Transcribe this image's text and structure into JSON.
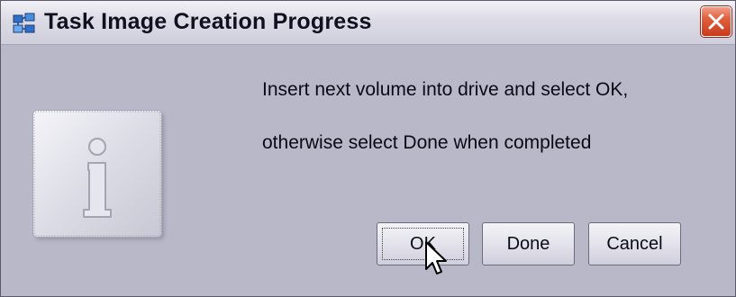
{
  "window": {
    "title": "Task Image Creation Progress",
    "app_icon": "task-image-creation-icon",
    "close_icon": "close-x-icon"
  },
  "dialog": {
    "icon": "information-icon",
    "message_line1": "Insert next volume into drive and select OK,",
    "message_line2": "otherwise select Done when completed"
  },
  "buttons": {
    "ok_label": "OK",
    "done_label": "Done",
    "cancel_label": "Cancel",
    "focused": "OK"
  },
  "colors": {
    "dialog_background": "#b9b8c9",
    "close_button": "#e0603e"
  }
}
